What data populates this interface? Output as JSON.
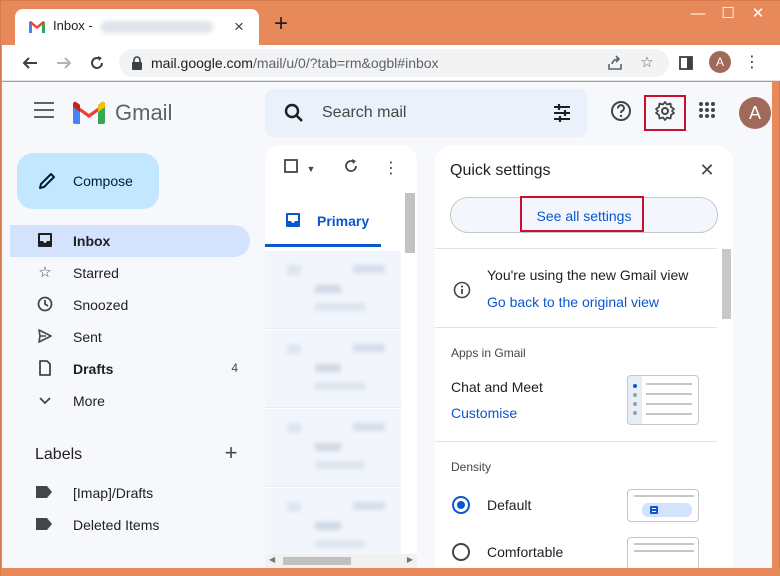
{
  "browser": {
    "tab_title": "Inbox -",
    "tab_close": "×",
    "new_tab": "+",
    "window_controls": [
      "—",
      "☐",
      "✕"
    ],
    "url_host": "mail.google.com",
    "url_path": "/mail/u/0/?tab=rm&ogbl#inbox",
    "profile_initial": "A",
    "menu_icon": "⋮"
  },
  "header": {
    "app_name": "Gmail",
    "search_placeholder": "Search mail",
    "avatar_initial": "A"
  },
  "compose": {
    "label": "Compose"
  },
  "nav": [
    {
      "label": "Inbox",
      "icon": "inbox-icon",
      "active": true,
      "bold": true,
      "count": ""
    },
    {
      "label": "Starred",
      "icon": "star-icon",
      "active": false,
      "bold": false,
      "count": ""
    },
    {
      "label": "Snoozed",
      "icon": "clock-icon",
      "active": false,
      "bold": false,
      "count": ""
    },
    {
      "label": "Sent",
      "icon": "send-icon",
      "active": false,
      "bold": false,
      "count": ""
    },
    {
      "label": "Drafts",
      "icon": "draft-icon",
      "active": false,
      "bold": true,
      "count": "4"
    },
    {
      "label": "More",
      "icon": "chevron-down-icon",
      "active": false,
      "bold": false,
      "count": ""
    }
  ],
  "labels": {
    "title": "Labels",
    "items": [
      "[Imap]/Drafts",
      "Deleted Items"
    ]
  },
  "maillist": {
    "primary_tab": "Primary"
  },
  "quick_settings": {
    "title": "Quick settings",
    "see_all": "See all settings",
    "info_text": "You're using the new Gmail view",
    "info_link": "Go back to the original view",
    "apps_title": "Apps in Gmail",
    "chat_meet": "Chat and Meet",
    "customise": "Customise",
    "density_title": "Density",
    "density_options": [
      "Default",
      "Comfortable"
    ],
    "density_selected": "Default"
  },
  "colors": {
    "accent": "#0b57d0",
    "highlight_box": "#c8102e",
    "window_frame": "#e8895b"
  }
}
